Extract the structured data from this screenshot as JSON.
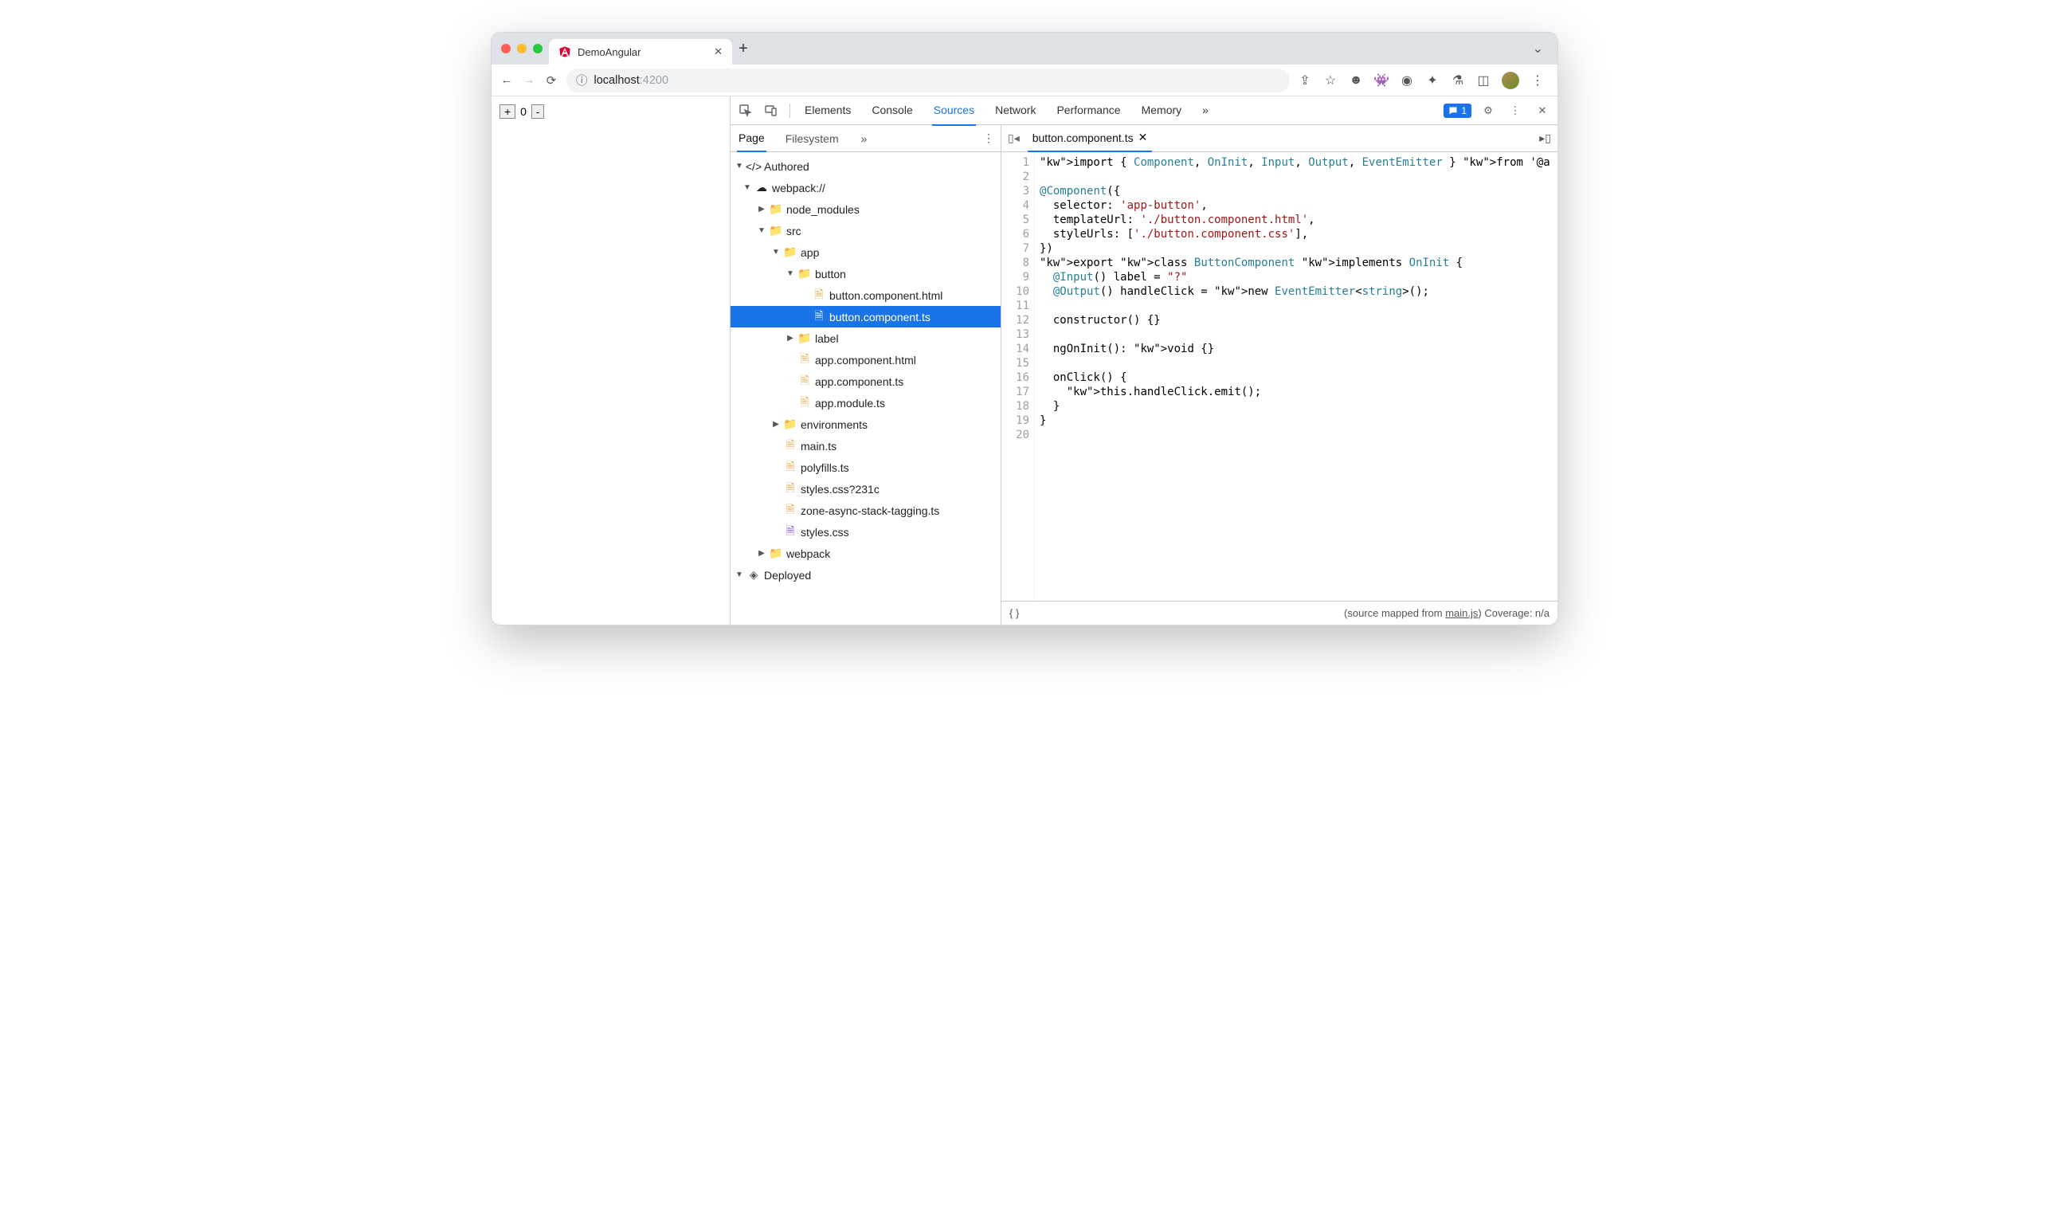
{
  "browser": {
    "tab_title": "DemoAngular",
    "address_host": "localhost",
    "address_port": ":4200",
    "page": {
      "plus": "+",
      "count": "0",
      "minus": "-"
    }
  },
  "devtools": {
    "panels": [
      "Elements",
      "Console",
      "Sources",
      "Network",
      "Performance",
      "Memory"
    ],
    "active_panel": "Sources",
    "more_panels": "»",
    "issues_count": "1",
    "sources_left_tabs": [
      "Page",
      "Filesystem"
    ],
    "sources_left_active": "Page",
    "sources_left_more": "»",
    "open_file": "button.component.ts",
    "status_source_mapped": "(source mapped from ",
    "status_main": "main.js",
    "status_coverage": ")  Coverage: n/a",
    "tree": {
      "authored": "Authored",
      "webpack": "webpack://",
      "node_modules": "node_modules",
      "src": "src",
      "app": "app",
      "button": "button",
      "button_html": "button.component.html",
      "button_ts": "button.component.ts",
      "label": "label",
      "app_html": "app.component.html",
      "app_ts": "app.component.ts",
      "app_module": "app.module.ts",
      "env": "environments",
      "main_ts": "main.ts",
      "polyfills": "polyfills.ts",
      "styles_q": "styles.css?231c",
      "zone": "zone-async-stack-tagging.ts",
      "styles": "styles.css",
      "webpack2": "webpack",
      "deployed": "Deployed"
    },
    "code_lines": [
      "import { Component, OnInit, Input, Output, EventEmitter } from '@a",
      "",
      "@Component({",
      "  selector: 'app-button',",
      "  templateUrl: './button.component.html',",
      "  styleUrls: ['./button.component.css'],",
      "})",
      "export class ButtonComponent implements OnInit {",
      "  @Input() label = \"?\"",
      "  @Output() handleClick = new EventEmitter<string>();",
      "",
      "  constructor() {}",
      "",
      "  ngOnInit(): void {}",
      "",
      "  onClick() {",
      "    this.handleClick.emit();",
      "  }",
      "}",
      ""
    ]
  }
}
